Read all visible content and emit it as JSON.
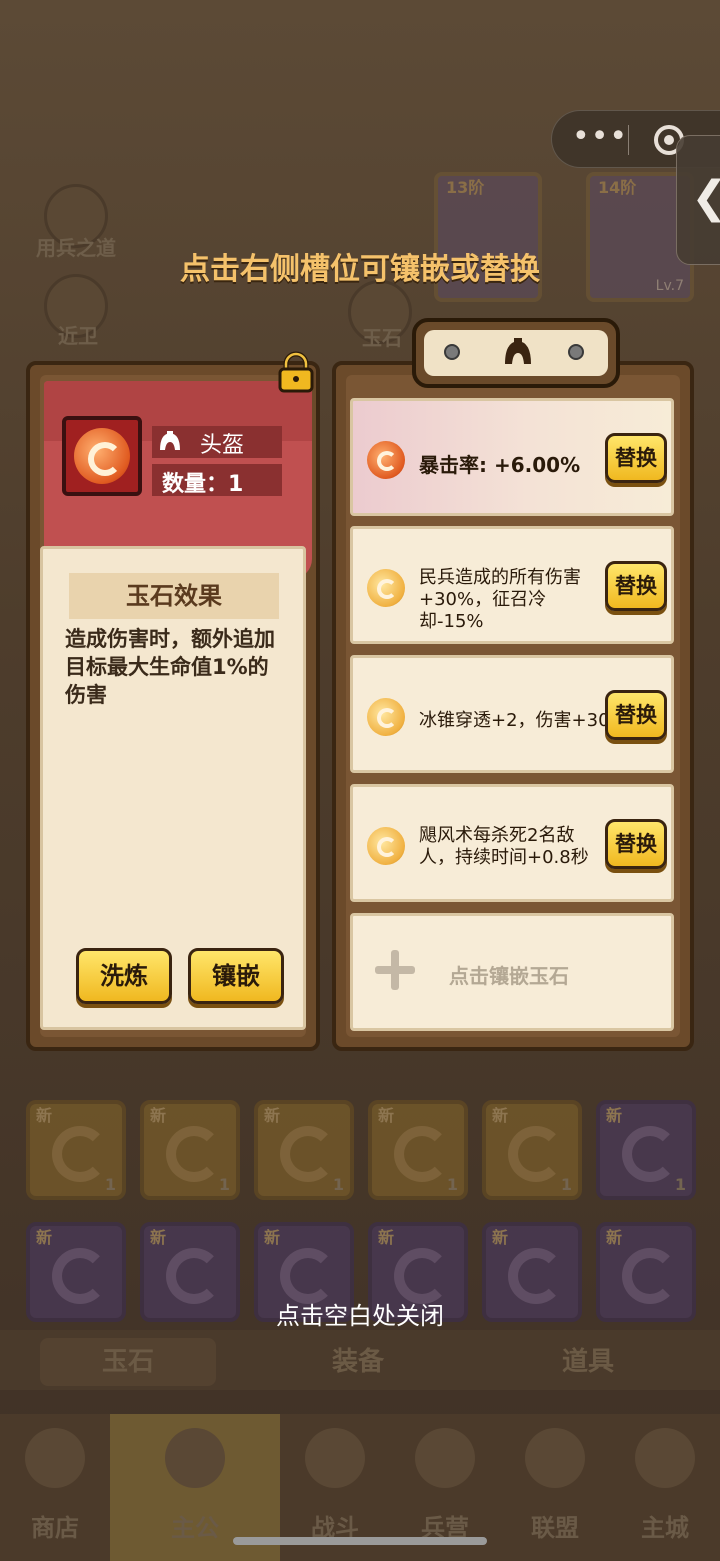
{
  "background": {
    "top_labels": [
      "用兵之道",
      "近卫",
      "玉石"
    ],
    "cards": [
      {
        "stage": "13阶",
        "level": ""
      },
      {
        "stage": "14阶",
        "level": "Lv.7"
      }
    ],
    "tabs": [
      "玉石",
      "装备",
      "道具"
    ],
    "nav": [
      "商店",
      "主公",
      "战斗",
      "兵营",
      "联盟",
      "主城"
    ],
    "slot_new_label": "新",
    "slot_count": "1"
  },
  "hint_top": "点击右侧槽位可镶嵌或替换",
  "hint_bottom": "点击空白处关闭",
  "gem_detail": {
    "slot_name": "头盔",
    "count_label": "数量：1",
    "effect_title": "玉石效果",
    "effect_text": "造成伤害时，额外追加目标最大生命值1%的伤害",
    "refine_label": "洗炼",
    "inlay_label": "镶嵌"
  },
  "slots": [
    {
      "stat": "暴击率: +6.00%",
      "button": "替换",
      "gem": "red"
    },
    {
      "stat": "民兵造成的所有伤害+30%，征召冷却-15%",
      "button": "替换",
      "gem": "gold"
    },
    {
      "stat": "冰锥穿透+2，伤害+30%",
      "button": "替换",
      "gem": "gold"
    },
    {
      "stat": "飓风术每杀死2名敌人，持续时间+0.8秒",
      "button": "替换",
      "gem": "gold"
    }
  ],
  "empty_slot_label": "点击镶嵌玉石",
  "colors": {
    "hint": "#f5c26b",
    "button_yellow": "#f0b820",
    "banner_red": "#c05050",
    "paper": "#f4e7cf"
  }
}
